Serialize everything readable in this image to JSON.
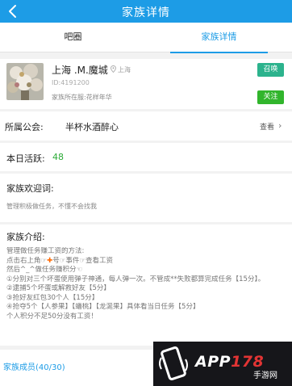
{
  "header": {
    "title": "家族详情"
  },
  "tabs": [
    {
      "label": "吧圈",
      "active": false
    },
    {
      "label": "家族详情",
      "active": true
    }
  ],
  "clan": {
    "name": "上海 .M.魔城",
    "location": "上海",
    "id_text": "ID:4191200",
    "zone_text": "家族所在服:花样年华",
    "summon_label": "召唤",
    "follow_label": "关注"
  },
  "guild": {
    "label": "所属公会:",
    "value": "半杯水酒醉心",
    "more_label": "查看",
    "chevron": "›"
  },
  "activity": {
    "label": "本日活跃:",
    "value": "48"
  },
  "welcome": {
    "label": "家族欢迎词:",
    "text": "管理积极做任务，不懂不会找我"
  },
  "intro": {
    "label": "家族介绍:",
    "lines": [
      "管理做任务赚工资的方法:",
      "点击右上角☞",
      "号☞事件☞查看工资",
      "然后^_^做任务赚积分☜",
      "①分别对三个坏蛋使用弹子神通，每人弹一次。不管成**失败都算完成任务【15分】。",
      "②逮捕5个坏蛋或解救好友【5分】",
      "③抢好友红包30个人【15分】",
      "④抢夺5个【人参果】【蟠桃】【龙涎果】具体看当日任务【5分】",
      "个人积分不足50分没有工资！"
    ]
  },
  "members": {
    "label": "家族成员(40/30)"
  },
  "watermark": {
    "brand_prefix": "APP",
    "brand_number": "178",
    "brand_suffix": "手游网"
  },
  "colors": {
    "accent": "#1d9ce6",
    "summon": "#2cb38d",
    "follow": "#31b52c",
    "activity_value": "#2cab37"
  },
  "icons": {
    "back": "back-arrow-icon",
    "location": "location-pin-icon",
    "chevron": "chevron-right-icon",
    "cross": "cross-icon"
  }
}
